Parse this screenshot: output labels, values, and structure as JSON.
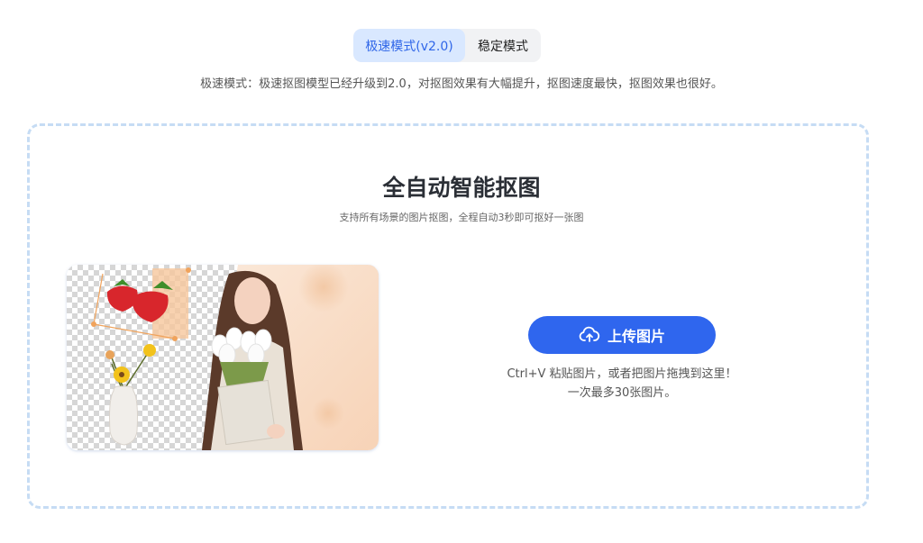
{
  "mode_tabs": [
    {
      "label": "极速模式(v2.0)",
      "active": true
    },
    {
      "label": "稳定模式",
      "active": false
    }
  ],
  "mode_description": "极速模式：极速抠图模型已经升级到2.0，对抠图效果有大幅提升，抠图速度最快，抠图效果也很好。",
  "upload_area": {
    "title": "全自动智能抠图",
    "subtitle": "支持所有场景的图片抠图，全程自动3秒即可抠好一张图",
    "upload_button_label": "上传图片",
    "upload_icon": "cloud-upload-icon",
    "hint_line1": "Ctrl+V 粘贴图片，或者把图片拖拽到这里！",
    "hint_line2": "一次最多30张图片。"
  },
  "colors": {
    "accent": "#2f66ee",
    "active_tab_bg": "#d9e8ff",
    "active_tab_text": "#2f66e8",
    "dashed_border": "#c6dcf4"
  }
}
